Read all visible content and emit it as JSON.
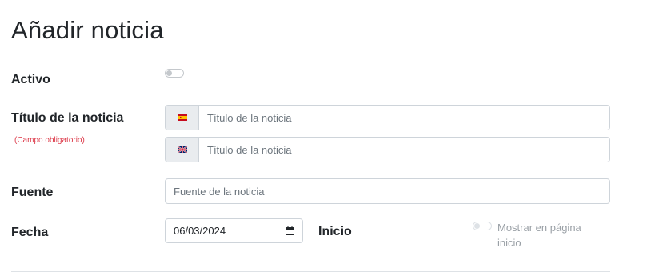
{
  "page": {
    "title": "Añadir noticia"
  },
  "form": {
    "active": {
      "label": "Activo",
      "on": false
    },
    "news_title": {
      "label": "Título de la noticia",
      "required_note": "(Campo obligatorio)",
      "fields": [
        {
          "flag_icon": "spain-flag-icon",
          "placeholder": "Título de la noticia",
          "value": ""
        },
        {
          "flag_icon": "uk-flag-icon",
          "placeholder": "Título de la noticia",
          "value": ""
        }
      ]
    },
    "source": {
      "label": "Fuente",
      "placeholder": "Fuente de la noticia",
      "value": ""
    },
    "date": {
      "label": "Fecha",
      "value": "06/03/2024",
      "icon": "calendar-icon"
    },
    "home": {
      "label": "Inicio",
      "toggle_label": "Mostrar en página inicio",
      "on": false,
      "disabled": true
    }
  },
  "colors": {
    "required": "#dc3545",
    "addon_bg": "#e9ecef",
    "border": "#ced4da"
  }
}
